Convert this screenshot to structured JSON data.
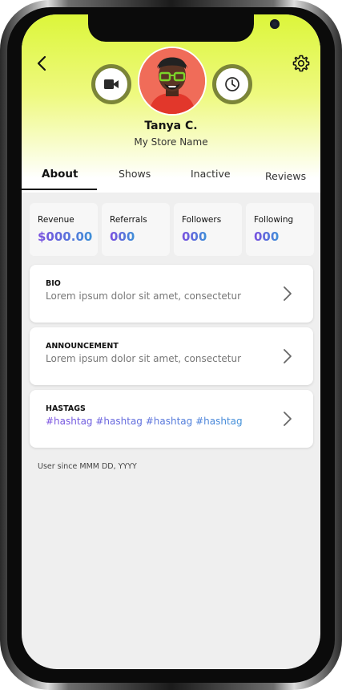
{
  "profile": {
    "name": "Tanya C.",
    "store_name": "My Store Name"
  },
  "tabs": [
    {
      "label": "About",
      "active": true
    },
    {
      "label": "Shows",
      "active": false
    },
    {
      "label": "Inactive",
      "active": false
    },
    {
      "label": "Reviews",
      "active": false
    }
  ],
  "stats": [
    {
      "label": "Revenue",
      "value": "$000.00"
    },
    {
      "label": "Referrals",
      "value": "000"
    },
    {
      "label": "Followers",
      "value": "000"
    },
    {
      "label": "Following",
      "value": "000"
    }
  ],
  "cards": [
    {
      "title": "BIO",
      "text": "Lorem ipsum dolor sit amet, consectetur"
    },
    {
      "title": "ANNOUNCEMENT",
      "text": "Lorem ipsum dolor sit amet, consectetur"
    },
    {
      "title": "HASTAGS",
      "text": "#hashtag #hashtag #hashtag #hashtag"
    }
  ],
  "footer": {
    "user_since": "User since MMM DD, YYYY"
  },
  "icons": {
    "back": "chevron-left-icon",
    "settings": "gear-icon",
    "video": "video-camera-icon",
    "history": "clock-icon",
    "chevron": "chevron-right-icon"
  },
  "colors": {
    "header_top": "#dcf63a",
    "accent_ring": "#7b8538",
    "value_gradient_start": "#7a4fe0",
    "value_gradient_end": "#3e8fd8",
    "avatar_bg": "#f06c59"
  }
}
